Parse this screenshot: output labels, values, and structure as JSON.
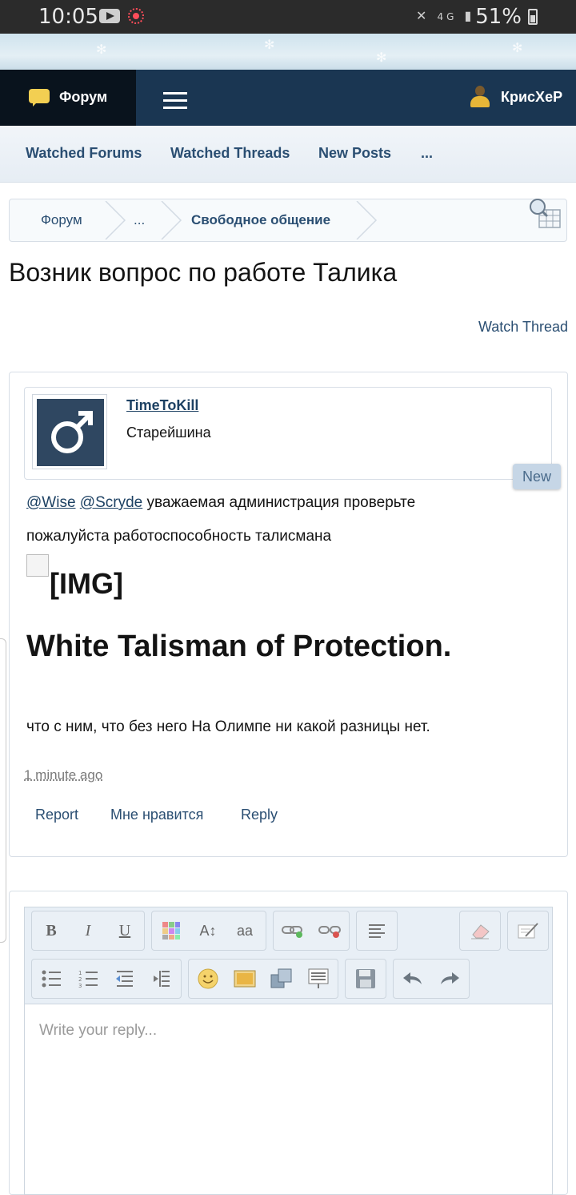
{
  "status_bar": {
    "time": "10:05",
    "battery": "51%",
    "network": "4G"
  },
  "top_nav": {
    "forum_label": "Форум",
    "user_name": "КрисХеР"
  },
  "sub_nav": {
    "items": [
      "Watched Forums",
      "Watched Threads",
      "New Posts",
      "..."
    ]
  },
  "breadcrumb": {
    "items": [
      "Форум",
      "...",
      "Свободное общение"
    ]
  },
  "thread": {
    "title": "Возник вопрос по работе Талика",
    "watch_label": "Watch Thread"
  },
  "post": {
    "author": "TimeToKill",
    "author_title": "Старейшина",
    "badge": "New",
    "mention_1": "@Wise",
    "mention_2": "@Scryde",
    "line_1_rest": " уважаемая администрация проверьте",
    "line_2": "пожалуйста работоспособность талисмана",
    "image_alt": "[IMG]",
    "heading": "White Talisman of Protection.",
    "line_3": "что с ним, что без него На Олимпе ни какой разницы нет.",
    "timestamp": "1 minute ago",
    "actions": [
      "Report",
      "Мне нравится",
      "Reply"
    ]
  },
  "editor": {
    "placeholder": "Write your reply...",
    "toolbar_row_1": [
      "bold-icon",
      "italic-icon",
      "underline-icon",
      "color-icon",
      "font-size-icon",
      "font-family-icon",
      "link-icon",
      "unlink-icon",
      "align-icon",
      "remove-format-icon",
      "source-icon"
    ],
    "toolbar_row_2": [
      "bullet-list-icon",
      "numbered-list-icon",
      "outdent-icon",
      "indent-icon",
      "smilie-icon",
      "image-icon",
      "media-icon",
      "quote-icon",
      "save-draft-icon",
      "undo-icon",
      "redo-icon"
    ],
    "toolbar_glyphs": {
      "bold": "B",
      "italic": "I",
      "underline": "U",
      "font_size": "A↕",
      "font_family": "aa"
    }
  },
  "colors": {
    "nav_bg": "#1a3652",
    "nav_forum_bg": "#09131d",
    "link": "#2a4e72",
    "accent_yellow": "#f3cf52"
  }
}
